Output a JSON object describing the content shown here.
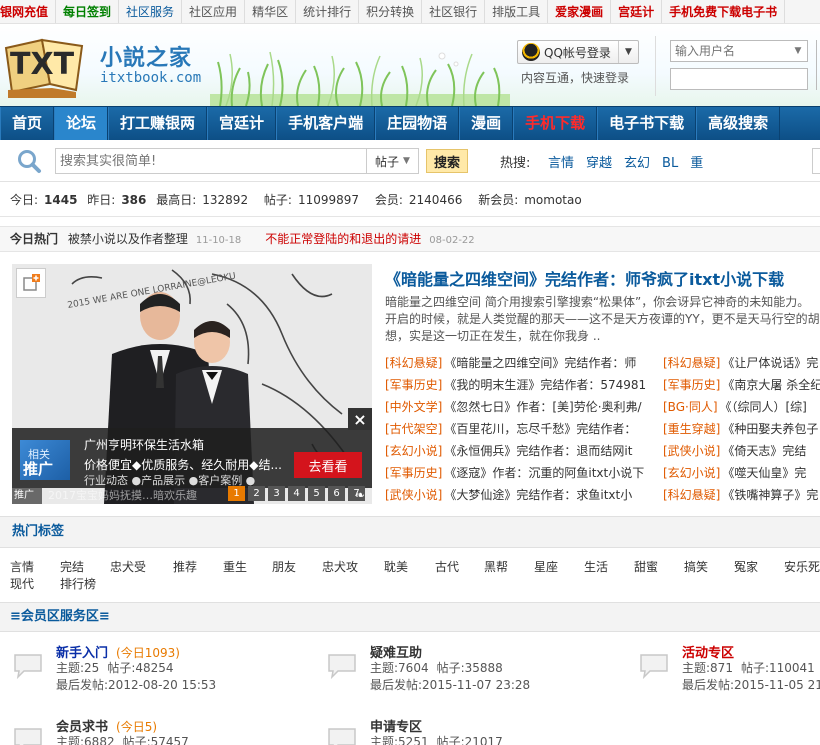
{
  "topbar": {
    "links": [
      {
        "label": "银网充值",
        "style": "red"
      },
      {
        "label": "每日签到",
        "style": "green"
      },
      {
        "label": "社区服务",
        "style": "blue"
      },
      {
        "label": "社区应用",
        "style": "normal"
      },
      {
        "label": "精华区",
        "style": "normal"
      },
      {
        "label": "统计排行",
        "style": "normal"
      },
      {
        "label": "积分转换",
        "style": "normal"
      },
      {
        "label": "社区银行",
        "style": "normal"
      },
      {
        "label": "排版工具",
        "style": "normal"
      },
      {
        "label": "爱家漫画",
        "style": "red"
      },
      {
        "label": "宫廷计",
        "style": "red"
      },
      {
        "label": "手机免费下载电子书",
        "style": "red"
      }
    ]
  },
  "header": {
    "logo_txt": "TXT",
    "logo_cn": "小説之家",
    "logo_url": "itxtbook.com",
    "qq_login": "QQ帐号登录",
    "qq_sub": "内容互通，快速登录",
    "username_placeholder": "输入用户名"
  },
  "nav": {
    "items": [
      {
        "label": "首页",
        "style": "normal"
      },
      {
        "label": "论坛",
        "style": "active"
      },
      {
        "label": "打工赚银两",
        "style": "normal"
      },
      {
        "label": "宫廷计",
        "style": "normal"
      },
      {
        "label": "手机客户端",
        "style": "normal"
      },
      {
        "label": "庄园物语",
        "style": "normal"
      },
      {
        "label": "漫画",
        "style": "normal"
      },
      {
        "label": "手机下载",
        "style": "red"
      },
      {
        "label": "电子书下载",
        "style": "normal"
      },
      {
        "label": "高级搜索",
        "style": "normal"
      }
    ]
  },
  "search": {
    "placeholder": "搜索其实很简单!",
    "type": "帖子",
    "button": "搜索",
    "hot_label": "热搜:",
    "hot_words": [
      "言情",
      "穿越",
      "玄幻",
      "BL",
      "重"
    ]
  },
  "stats": {
    "today_label": "今日:",
    "today": "1445",
    "yesterday_label": "昨日:",
    "yesterday": "386",
    "max_label": "最高日:",
    "max": "132892",
    "posts_label": "帖子:",
    "posts": "11099897",
    "members_label": "会员:",
    "members": "2140466",
    "newest_label": "新会员:",
    "newest": "momotao"
  },
  "today_hot": {
    "label": "今日热门",
    "items": [
      {
        "title": "被禁小说以及作者整理",
        "date": "11-10-18",
        "color": "normal"
      },
      {
        "title": "不能正常登陆的和退出的请进",
        "date": "08-02-22",
        "color": "red"
      }
    ]
  },
  "slide": {
    "ad_related": "相关",
    "ad_push": "推广",
    "ad_title": "广州亨明环保生活水箱",
    "ad_desc": "价格便宜◆优质服务、经久耐用◆结...",
    "ad_button": "去看看",
    "ad_links": "行业动态 ●产品展示 ●客户案例 ●",
    "ad_chip": "推广",
    "ad_close": "×",
    "caption": "2017宝宝妈妈抚摸…暗欢乐趣",
    "pages": [
      "1",
      "2",
      "3",
      "4",
      "5",
      "6",
      "7"
    ],
    "active_page": 1
  },
  "featured": {
    "title": "《暗能量之四维空间》完结作者：师爷疯了itxt小说下载",
    "desc": "暗能量之四维空间 简介用搜索引擎搜索“松果体”，你会讶异它神奇的未知能力。开启的时候，就是人类觉醒的那天——这不是天方夜谭的YY，更不是天马行空的胡想，实是这一切正在发生，就在你我身 .."
  },
  "books": [
    {
      "tag1": "[科幻悬疑]",
      "text1": "《暗能量之四维空间》完结作者：师",
      "tag2": "[科幻悬疑]",
      "text2": "《让尸体说话》完"
    },
    {
      "tag1": "[军事历史]",
      "text1": "《我的明末生涯》完结作者：574981",
      "tag2": "[军事历史]",
      "text2": "《南京大屠 杀全纪"
    },
    {
      "tag1": "[中外文学]",
      "text1": "《忽然七日》作者：[美]劳伦·奥利弗/",
      "tag2": "[BG·同人]",
      "text2": "《（综同人）[综]"
    },
    {
      "tag1": "[古代架空]",
      "text1": "《百里花川，忘尽千愁》完结作者：",
      "tag2": "[重生穿越]",
      "text2": "《种田娶夫养包子"
    },
    {
      "tag1": "[玄幻小说]",
      "text1": "《永恒佣兵》完结作者：退而结网it",
      "tag2": "[武侠小说]",
      "text2": "《倚天志》完结"
    },
    {
      "tag1": "[军事历史]",
      "text1": "《逐寇》作者：沉重的阿鱼itxt小说下",
      "tag2": "[玄幻小说]",
      "text2": "《噬天仙皇》完"
    },
    {
      "tag1": "[武侠小说]",
      "text1": "《大梦仙途》完结作者：求鱼itxt小",
      "tag2": "[科幻悬疑]",
      "text2": "《铁嘴神算子》完"
    }
  ],
  "tags": {
    "heading": "热门标签",
    "items": [
      "言情",
      "完结",
      "忠犬受",
      "推荐",
      "重生",
      "朋友",
      "忠犬攻",
      "耽美",
      "古代",
      "黑帮",
      "星座",
      "生活",
      "甜蜜",
      "搞笑",
      "冤家",
      "安乐死",
      "现代",
      "排行榜"
    ]
  },
  "zone": {
    "heading": "≡会员区服务区≡",
    "topic_label": "主题:",
    "post_label": "帖子:",
    "last_label": "最后发帖:",
    "forums": [
      {
        "name": "新手入门",
        "today": "(今日1093)",
        "topics": "25",
        "posts": "48254",
        "last": "2012-08-20 15:53",
        "color": "#0a2fa8"
      },
      {
        "name": "疑难互助",
        "today": "",
        "topics": "7604",
        "posts": "35888",
        "last": "2015-11-07 23:28",
        "color": "#333333"
      },
      {
        "name": "活动专区",
        "today": "",
        "topics": "871",
        "posts": "110041",
        "last": "2015-11-05 21:3",
        "color": "#cc0000"
      },
      {
        "name": "会员求书",
        "today": "(今日5)",
        "topics": "6882",
        "posts": "57457",
        "last": "",
        "color": "#333333"
      },
      {
        "name": "申请专区",
        "today": "",
        "topics": "5251",
        "posts": "21017",
        "last": "",
        "color": "#333333"
      }
    ]
  }
}
